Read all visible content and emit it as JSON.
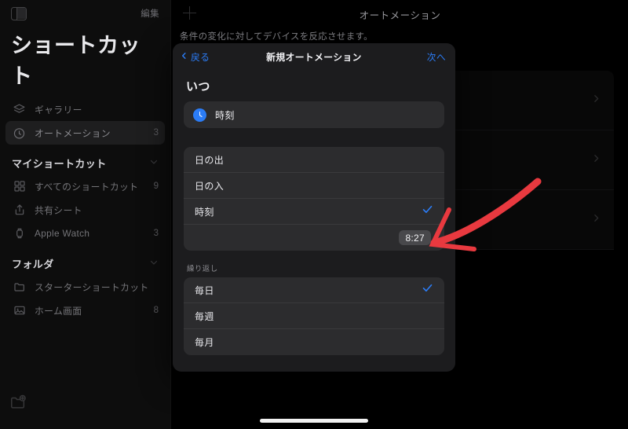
{
  "sidebar": {
    "toggle_icon": "sidebar-toggle-icon",
    "edit_label": "編集",
    "title": "ショートカット",
    "items": [
      {
        "label": "ギャラリー",
        "icon": "layers-icon",
        "count": ""
      },
      {
        "label": "オートメーション",
        "icon": "clock-badge-icon",
        "count": "3",
        "selected": true
      }
    ],
    "sections": [
      {
        "label": "マイショートカット",
        "chevron": "chevron-down-icon",
        "items": [
          {
            "label": "すべてのショートカット",
            "icon": "grid-icon",
            "count": "9"
          },
          {
            "label": "共有シート",
            "icon": "share-icon",
            "count": ""
          },
          {
            "label": "Apple Watch",
            "icon": "watch-icon",
            "count": "3"
          }
        ]
      },
      {
        "label": "フォルダ",
        "chevron": "chevron-down-icon",
        "items": [
          {
            "label": "スターターショートカット",
            "icon": "folder-icon",
            "count": ""
          },
          {
            "label": "ホーム画面",
            "icon": "photo-icon",
            "count": "8"
          }
        ]
      }
    ],
    "new_folder_icon": "folder-plus-icon"
  },
  "content": {
    "add_icon": "plus-icon",
    "title": "オートメーション",
    "subtitle": "条件の変化に対してデバイスを反応させます。",
    "rows": [
      {
        "chevron": "chevron-right-icon"
      },
      {
        "chevron": "chevron-right-icon"
      },
      {
        "chevron": "chevron-right-icon"
      }
    ]
  },
  "modal": {
    "back_label": "戻る",
    "back_icon": "chevron-left-icon",
    "title": "新規オートメーション",
    "next_label": "次へ",
    "when_heading": "いつ",
    "trigger": {
      "label": "時刻",
      "icon": "clock-icon"
    },
    "time_options": [
      {
        "label": "日の出",
        "checked": false
      },
      {
        "label": "日の入",
        "checked": false
      },
      {
        "label": "時刻",
        "checked": true
      }
    ],
    "selected_time": "8:27",
    "repeat_label": "繰り返し",
    "repeat_options": [
      {
        "label": "毎日",
        "checked": true
      },
      {
        "label": "毎週",
        "checked": false
      },
      {
        "label": "毎月",
        "checked": false
      }
    ]
  },
  "annotation": {
    "type": "red-arrow",
    "color": "#e8393f",
    "points_to": "8:27"
  },
  "colors": {
    "accent_blue": "#2b7cf6",
    "modal_bg": "#1c1c1e",
    "card_bg": "#2c2c2e",
    "sidebar_bg": "#0d0d0d",
    "annotation_red": "#e8393f"
  }
}
